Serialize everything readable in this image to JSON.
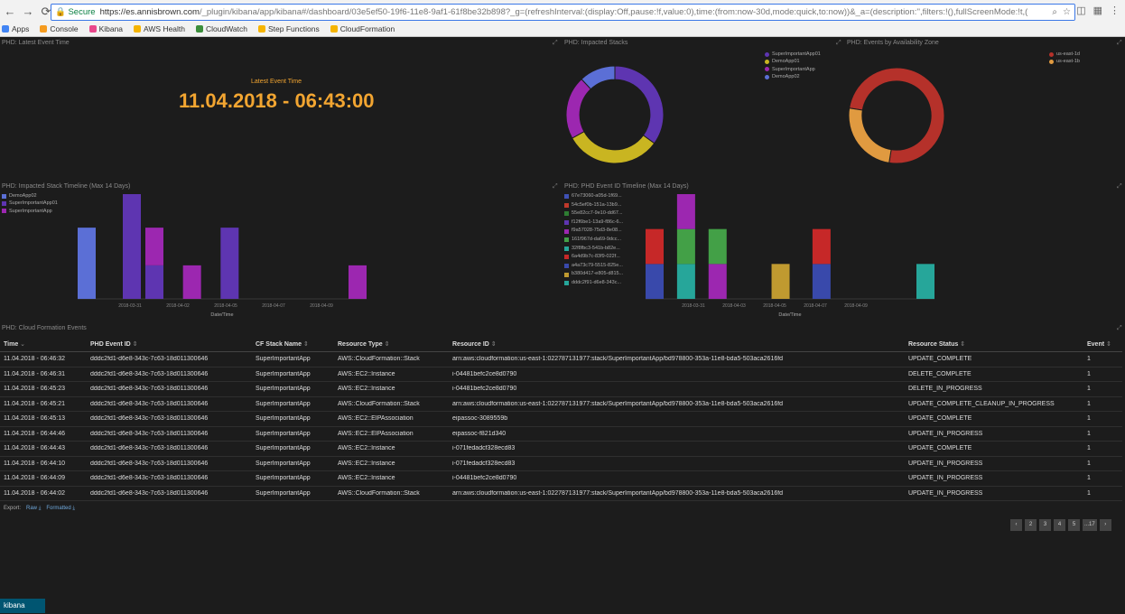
{
  "browser": {
    "secure_label": "Secure",
    "url_host": "https://es.annisbrown.com",
    "url_path": "/_plugin/kibana/app/kibana#/dashboard/03e5ef50-19f6-11e8-9af1-61f8be32b898?_g=(refreshInterval:(display:Off,pause:!f,value:0),time:(from:now-30d,mode:quick,to:now))&_a=(description:'',filters:!(),fullScreenMode:!t,(",
    "bookmarks": [
      {
        "label": "Apps",
        "color": "#4285f4"
      },
      {
        "label": "Console",
        "color": "#f59b1f"
      },
      {
        "label": "Kibana",
        "color": "#e8478b"
      },
      {
        "label": "AWS Health",
        "color": "#f5b400"
      },
      {
        "label": "CloudWatch",
        "color": "#3b8e3b"
      },
      {
        "label": "Step Functions",
        "color": "#f5b400"
      },
      {
        "label": "CloudFormation",
        "color": "#f5b400"
      }
    ]
  },
  "panels": {
    "latest_event": {
      "title": "PHD: Latest Event Time",
      "label": "Latest Event Time",
      "value": "11.04.2018 - 06:43:00"
    },
    "impacted_stacks": {
      "title": "PHD: Impacted Stacks"
    },
    "events_by_az": {
      "title": "PHD: Events by Availability Zone"
    },
    "stack_timeline": {
      "title": "PHD: Impacted Stack Timeline (Max 14 Days)"
    },
    "event_id_timeline": {
      "title": "PHD: PHD Event ID Timeline (Max 14 Days)"
    },
    "cf_events": {
      "title": "PHD: Cloud Formation Events"
    }
  },
  "chart_data": [
    {
      "type": "pie",
      "donut": true,
      "series": [
        {
          "name": "SuperImportantApp01",
          "value": 35,
          "color": "#5e35b1"
        },
        {
          "name": "DemoApp01",
          "value": 32,
          "color": "#c9b521"
        },
        {
          "name": "SuperImportantApp",
          "value": 21,
          "color": "#9c27b0"
        },
        {
          "name": "DemoApp02",
          "value": 12,
          "color": "#5b6fd6"
        }
      ]
    },
    {
      "type": "pie",
      "donut": true,
      "series": [
        {
          "name": "us-east-1d",
          "value": 75,
          "color": "#b5312a"
        },
        {
          "name": "us-east-1b",
          "value": 25,
          "color": "#e09a40"
        }
      ]
    },
    {
      "type": "bar",
      "stacked": true,
      "xlabel": "Date/Time",
      "x_ticks": [
        "2018-03-31",
        "2018-04-02",
        "2018-04-05",
        "2018-04-07",
        "2018-04-09"
      ],
      "ylim": [
        0,
        2.5
      ],
      "bars": [
        {
          "x": 0.0,
          "segments": [
            {
              "series": "DemoApp02",
              "value": 1.7
            }
          ]
        },
        {
          "x": 1.2,
          "segments": [
            {
              "series": "SuperImportantApp01",
              "value": 2.5
            }
          ]
        },
        {
          "x": 1.8,
          "segments": [
            {
              "series": "SuperImportantApp01",
              "value": 0.8
            },
            {
              "series": "SuperImportantApp",
              "value": 0.9
            }
          ]
        },
        {
          "x": 2.8,
          "segments": [
            {
              "series": "SuperImportantApp",
              "value": 0.8
            }
          ]
        },
        {
          "x": 3.8,
          "segments": [
            {
              "series": "SuperImportantApp01",
              "value": 1.7
            }
          ]
        },
        {
          "x": 7.2,
          "segments": [
            {
              "series": "SuperImportantApp",
              "value": 0.8
            }
          ]
        }
      ],
      "series": [
        {
          "name": "DemoApp02",
          "color": "#5b6fd6"
        },
        {
          "name": "SuperImportantApp01",
          "color": "#5e35b1"
        },
        {
          "name": "SuperImportantApp",
          "color": "#9c27b0"
        }
      ]
    },
    {
      "type": "bar",
      "stacked": true,
      "xlabel": "Date/Time",
      "x_ticks": [
        "2018-03-31",
        "2018-04-03",
        "2018-04-05",
        "2018-04-07",
        "2018-04-09"
      ],
      "ylim": [
        0,
        3
      ],
      "bars": [
        {
          "x": 0.0,
          "segments": [
            {
              "series": "a4a73c79",
              "value": 1
            },
            {
              "series": "6a4d9b7c",
              "value": 1
            }
          ]
        },
        {
          "x": 1.0,
          "segments": [
            {
              "series": "32f8fbc3",
              "value": 1
            },
            {
              "series": "161f967d",
              "value": 1
            },
            {
              "series": "f9a57028",
              "value": 1
            }
          ]
        },
        {
          "x": 2.0,
          "segments": [
            {
              "series": "f9a57028",
              "value": 1
            },
            {
              "series": "161f967d",
              "value": 1
            }
          ]
        },
        {
          "x": 4.0,
          "segments": [
            {
              "series": "b380d417",
              "value": 1
            }
          ]
        },
        {
          "x": 5.3,
          "segments": [
            {
              "series": "a4a73c79",
              "value": 1
            },
            {
              "series": "6a4d9b7c",
              "value": 1
            }
          ]
        },
        {
          "x": 8.6,
          "segments": [
            {
              "series": "dddc2f91",
              "value": 1
            }
          ]
        }
      ],
      "series": [
        {
          "name": "67e73060-a05d-1f69...",
          "color": "#3f51b5"
        },
        {
          "name": "54c5ef0b-151a-13b9...",
          "color": "#c0392b"
        },
        {
          "name": "55e82cc7-9e10-dd67...",
          "color": "#2e7d32"
        },
        {
          "name": "f12f6be1-13a9-f86c-6...",
          "color": "#5e35b1"
        },
        {
          "name": "f9a57028-75d3-8e08...",
          "color": "#9c27b0"
        },
        {
          "name": "161f967d-da69-9dcc...",
          "color": "#43a047"
        },
        {
          "name": "32f8fbc3-541b-b82e...",
          "color": "#26a69a"
        },
        {
          "name": "6a4d9b7c-83f9-022f...",
          "color": "#c62828"
        },
        {
          "name": "a4a73c79-5515-825e...",
          "color": "#3949ab"
        },
        {
          "name": "b380d417-e805-d815...",
          "color": "#c09a30"
        },
        {
          "name": "dddc2f91-d6e8-343c...",
          "color": "#26a69a"
        }
      ]
    }
  ],
  "table": {
    "headers": [
      "Time",
      "PHD Event ID",
      "CF Stack Name",
      "Resource Type",
      "Resource ID",
      "Resource Status",
      "Event"
    ],
    "rows": [
      [
        "11.04.2018 - 06:46:32",
        "dddc2fd1-d6e8-343c-7c63-18d011300646",
        "SuperImportantApp",
        "AWS::CloudFormation::Stack",
        "arn:aws:cloudformation:us-east-1:022787131977:stack/SuperImportantApp/bd978800-353a-11e8-bda5-503aca2616fd",
        "UPDATE_COMPLETE",
        "1"
      ],
      [
        "11.04.2018 - 06:46:31",
        "dddc2fd1-d6e8-343c-7c63-18d011300646",
        "SuperImportantApp",
        "AWS::EC2::Instance",
        "i-04481befc2ce8d0790",
        "DELETE_COMPLETE",
        "1"
      ],
      [
        "11.04.2018 - 06:45:23",
        "dddc2fd1-d6e8-343c-7c63-18d011300646",
        "SuperImportantApp",
        "AWS::EC2::Instance",
        "i-04481befc2ce8d0790",
        "DELETE_IN_PROGRESS",
        "1"
      ],
      [
        "11.04.2018 - 06:45:21",
        "dddc2fd1-d6e8-343c-7c63-18d011300646",
        "SuperImportantApp",
        "AWS::CloudFormation::Stack",
        "arn:aws:cloudformation:us-east-1:022787131977:stack/SuperImportantApp/bd978800-353a-11e8-bda5-503aca2616fd",
        "UPDATE_COMPLETE_CLEANUP_IN_PROGRESS",
        "1"
      ],
      [
        "11.04.2018 - 06:45:13",
        "dddc2fd1-d6e8-343c-7c63-18d011300646",
        "SuperImportantApp",
        "AWS::EC2::EIPAssociation",
        "eipassoc-3089559b",
        "UPDATE_COMPLETE",
        "1"
      ],
      [
        "11.04.2018 - 06:44:46",
        "dddc2fd1-d6e8-343c-7c63-18d011300646",
        "SuperImportantApp",
        "AWS::EC2::EIPAssociation",
        "eipassoc-f821d340",
        "UPDATE_IN_PROGRESS",
        "1"
      ],
      [
        "11.04.2018 - 06:44:43",
        "dddc2fd1-d6e8-343c-7c63-18d011300646",
        "SuperImportantApp",
        "AWS::EC2::Instance",
        "i-071fedadcf328ecd83",
        "UPDATE_COMPLETE",
        "1"
      ],
      [
        "11.04.2018 - 06:44:10",
        "dddc2fd1-d6e8-343c-7c63-18d011300646",
        "SuperImportantApp",
        "AWS::EC2::Instance",
        "i-071fedadcf328ecd83",
        "UPDATE_IN_PROGRESS",
        "1"
      ],
      [
        "11.04.2018 - 06:44:09",
        "dddc2fd1-d6e8-343c-7c63-18d011300646",
        "SuperImportantApp",
        "AWS::EC2::Instance",
        "i-04481befc2ce8d0790",
        "UPDATE_IN_PROGRESS",
        "1"
      ],
      [
        "11.04.2018 - 06:44:02",
        "dddc2fd1-d6e8-343c-7c63-18d011300646",
        "SuperImportantApp",
        "AWS::CloudFormation::Stack",
        "arn:aws:cloudformation:us-east-1:022787131977:stack/SuperImportantApp/bd978800-353a-11e8-bda5-503aca2616fd",
        "UPDATE_IN_PROGRESS",
        "1"
      ]
    ]
  },
  "export": {
    "label": "Export:",
    "raw": "Raw",
    "formatted": "Formatted"
  },
  "pager": [
    "‹",
    "2",
    "3",
    "4",
    "5",
    "...17",
    "›"
  ],
  "footer": {
    "app_name": "kibana"
  }
}
